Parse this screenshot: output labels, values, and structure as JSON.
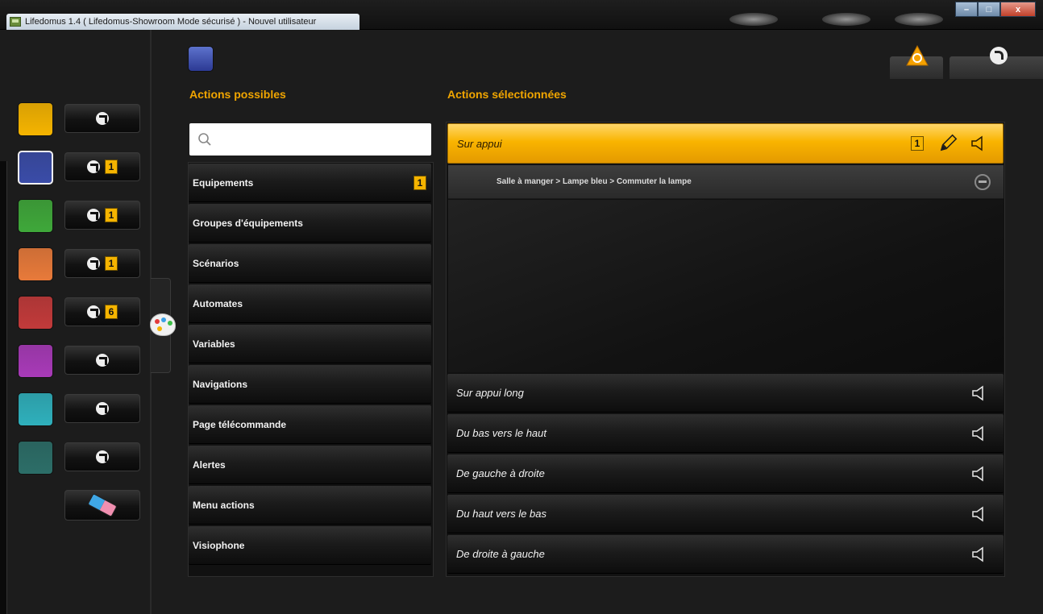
{
  "window": {
    "title": "Lifedomus 1.4 ( Lifedomus-Showroom Mode sécurisé ) - Nouvel utilisateur",
    "minimize_icon": "minimize-icon",
    "maximize_icon": "maximize-icon",
    "close_icon": "close-icon"
  },
  "colors": {
    "accent": "#f5b400",
    "background": "#1c1c1c"
  },
  "color_rows": [
    {
      "color": "#f5b400",
      "badge": ""
    },
    {
      "color": "#3a4ca8",
      "badge": "1",
      "selected": true
    },
    {
      "color": "#3fa83a",
      "badge": "1"
    },
    {
      "color": "#e87a3a",
      "badge": "1"
    },
    {
      "color": "#c23a3a",
      "badge": "6"
    },
    {
      "color": "#a83ab8",
      "badge": ""
    },
    {
      "color": "#2fb0bc",
      "badge": ""
    },
    {
      "color": "#2c6e68",
      "badge": ""
    }
  ],
  "header": {
    "possible_label": "Actions possibles",
    "selected_label": "Actions sélectionnées"
  },
  "search": {
    "placeholder": "",
    "value": ""
  },
  "possible_actions": [
    {
      "label": "Equipements",
      "badge": "1"
    },
    {
      "label": "Groupes d'équipements",
      "badge": ""
    },
    {
      "label": "Scénarios",
      "badge": ""
    },
    {
      "label": "Automates",
      "badge": ""
    },
    {
      "label": "Variables",
      "badge": ""
    },
    {
      "label": "Navigations",
      "badge": ""
    },
    {
      "label": "Page télécommande",
      "badge": ""
    },
    {
      "label": "Alertes",
      "badge": ""
    },
    {
      "label": "Menu actions",
      "badge": ""
    },
    {
      "label": "Visiophone",
      "badge": ""
    }
  ],
  "selected_actions": {
    "active": {
      "label": "Sur appui",
      "badge": "1"
    },
    "sub_item": "Salle à manger > Lampe bleu > Commuter la lampe",
    "others": [
      {
        "label": "Sur appui long"
      },
      {
        "label": "Du bas vers le haut"
      },
      {
        "label": "De gauche à droite"
      },
      {
        "label": "Du haut vers le bas"
      },
      {
        "label": "De droite à gauche"
      }
    ]
  }
}
